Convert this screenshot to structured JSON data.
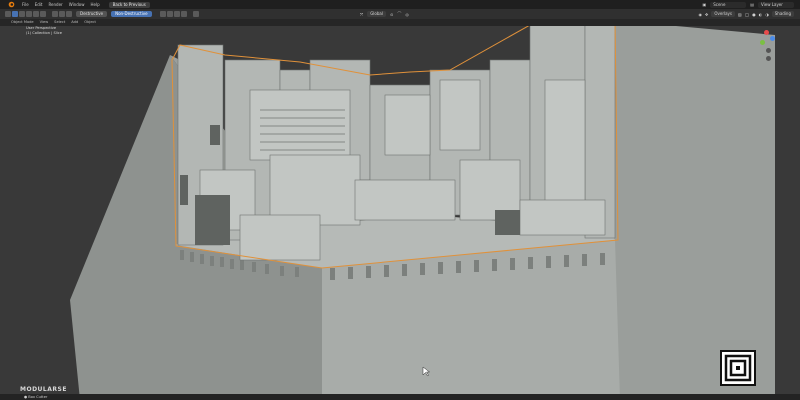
{
  "menubar": {
    "items": [
      "File",
      "Edit",
      "Render",
      "Window",
      "Help"
    ],
    "active_tab": "Back to Previous",
    "scene": "Scene",
    "view_layer": "View Layer"
  },
  "toolbar": {
    "mode_destructive": "Destructive",
    "mode_nondestructive": "Non-Destructive",
    "transform_orientation": "Global",
    "overlays": "Overlays",
    "shading": "Shading"
  },
  "viewheader": {
    "items": [
      "Object Mode",
      "View",
      "Select",
      "Add",
      "Object"
    ]
  },
  "viewport_info": {
    "line1": "User Perspective",
    "line2": "(1) Collection | Slice"
  },
  "gizmo_colors": [
    "#e84b4b",
    "#4b8be8",
    "#7bc043"
  ],
  "branding": "MODULARSE",
  "status": {
    "tool": "Box Cutter"
  },
  "colors": {
    "selection_outline": "#e0913a",
    "model": "#a7aba8",
    "background": "#393939"
  }
}
